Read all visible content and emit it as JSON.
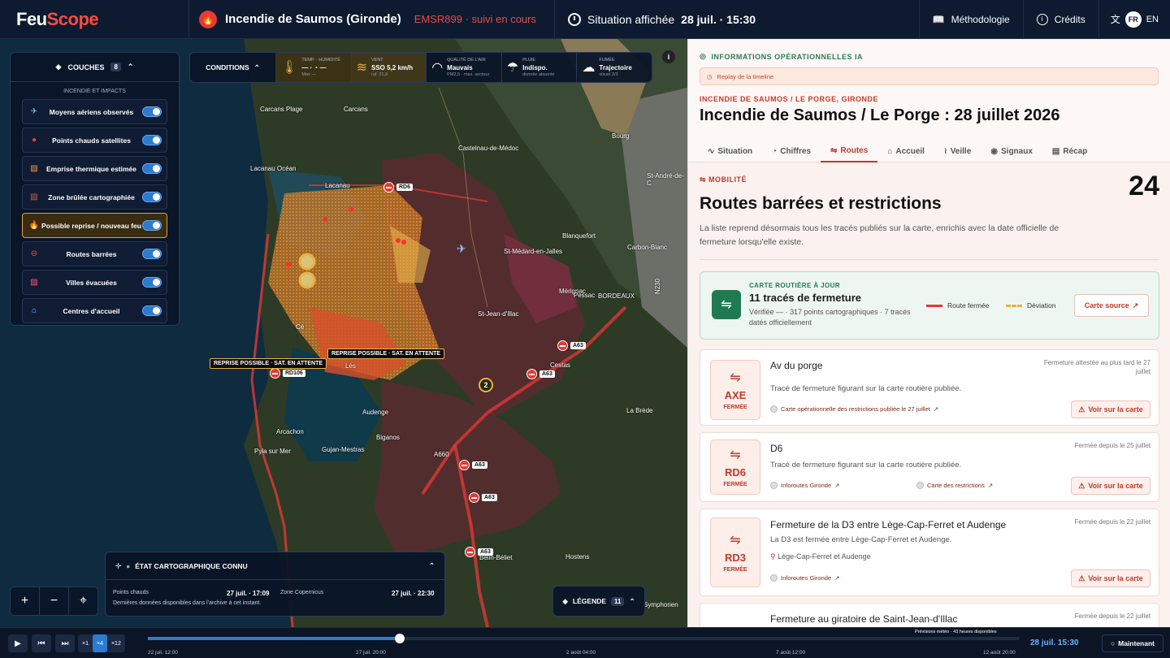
{
  "topbar": {
    "logo_a": "Feu",
    "logo_b": "Scope",
    "incident_title": "Incendie de Saumos (Gironde)",
    "incident_code": "EMSR899 · suivi en cours",
    "situation_label": "Situation affichée",
    "situation_time": "28 juil. · 15:30",
    "methodologie": "Méthodologie",
    "credits": "Crédits",
    "lang_fr": "FR",
    "lang_en": "EN"
  },
  "layers": {
    "title": "COUCHES",
    "count": "8",
    "section": "INCENDIE ET IMPACTS",
    "items": [
      {
        "label": "Moyens aériens observés",
        "icon": "plane-icon"
      },
      {
        "label": "Points chauds satellites",
        "icon": "hotspot-icon"
      },
      {
        "label": "Emprise thermique estimée",
        "icon": "thermal-icon"
      },
      {
        "label": "Zone brûlée cartographiée",
        "icon": "burned-icon"
      },
      {
        "label": "Possible reprise / nouveau feu",
        "icon": "flame-icon"
      },
      {
        "label": "Routes barrées",
        "icon": "road-block-icon"
      },
      {
        "label": "Villes évacuées",
        "icon": "evacuated-icon"
      },
      {
        "label": "Centres d'accueil",
        "icon": "shelter-icon"
      }
    ]
  },
  "conditions": {
    "title": "CONDITIONS",
    "items": [
      {
        "k": "TEMP. · HUMIDITÉ",
        "v": "— · ◔ —",
        "s": "Max —"
      },
      {
        "k": "VENT",
        "v": "SSO 5,2 km/h",
        "s": "raf. 21,8"
      },
      {
        "k": "QUALITÉ DE L'AIR",
        "v": "Mauvais",
        "s": "PM2,5 · max. secteur"
      },
      {
        "k": "PLUIE",
        "v": "Indispo.",
        "s": "donnée absente"
      },
      {
        "k": "FUMÉE",
        "v": "Trajectoire",
        "s": "visuel 2/3"
      }
    ]
  },
  "map": {
    "places": [
      "Carcans Plage",
      "Carcans",
      "Castelnau-de-Médoc",
      "Bourg",
      "Lacanau Océan",
      "Lacanau",
      "St-André-de-C",
      "Blanquefort",
      "Carbon-Blanc",
      "St-Médard-en-Jalles",
      "Mérignac",
      "BORDEAUX",
      "St-Jean-d'Illac",
      "Pessac",
      "Cestas",
      "Audenge",
      "La Brède",
      "Biganos",
      "Arcachon",
      "Gujan-Mestras",
      "Pyla sur Mer",
      "Belin-Béliet",
      "Hostens",
      "Symphorien",
      "N230",
      "A660",
      "Lès",
      "Cé"
    ],
    "roads": [
      "RD6",
      "RD106",
      "A63",
      "A63",
      "A63",
      "A63",
      "A63"
    ],
    "tags": [
      "REPRISE POSSIBLE · SAT. EN ATTENTE",
      "REPRISE POSSIBLE · SAT. EN ATTENTE"
    ],
    "cluster": "2"
  },
  "etat": {
    "title": "ÉTAT CARTOGRAPHIQUE CONNU",
    "pc_label": "Points chauds",
    "pc_value": "27 juil. · 17:09",
    "zc_label": "Zone Copernicus",
    "zc_value": "27 juil. · 22:30",
    "note": "Dernières données disponibles dans l'archive à cet instant."
  },
  "legend": {
    "label": "LÉGENDE",
    "count": "11"
  },
  "timeline": {
    "speeds": [
      "×1",
      "×4",
      "×12"
    ],
    "labels": [
      "22 juil. 12:00",
      "27 juil. 20:00",
      "2 août 04:00",
      "7 août 12:00",
      "12 août 20:00"
    ],
    "marker": "Maintenant",
    "forecast": "Prévisions météo · 43 heures disponibles",
    "current": "28 juil. 15:30",
    "now_btn": "Maintenant"
  },
  "panel": {
    "ai_info": "INFORMATIONS OPÉRATIONNELLES IA",
    "replay": "Replay de la timeline",
    "crumb": "INCENDIE DE SAUMOS / LE PORGE, GIRONDE",
    "title": "Incendie de Saumos / Le Porge : 28 juillet 2026",
    "tabs": [
      "Situation",
      "Chiffres",
      "Routes",
      "Accueil",
      "Veille",
      "Signaux",
      "Récap"
    ],
    "section_kicker": "MOBILITÉ",
    "count": "24",
    "h2": "Routes barrées et restrictions",
    "desc": "La liste reprend désormais tous les tracés publiés sur la carte, enrichis avec la date officielle de fermeture lorsqu'elle existe.",
    "carte": {
      "kicker": "CARTE ROUTIÈRE À JOUR",
      "title": "11 tracés de fermeture",
      "desc": "Vérifiée — · 317 points cartographiques · 7 tracés datés officiellement",
      "leg_closed": "Route fermée",
      "leg_detour": "Déviation",
      "source_btn": "Carte source"
    },
    "cards": [
      {
        "code": "AXE",
        "status": "FERMÉE",
        "name": "Av du porge",
        "date": "Fermeture attestée au plus tard le 27 juillet",
        "text": "Tracé de fermeture figurant sur la carte routière publiée.",
        "src1": "Carte opérationnelle des restrictions publiée le 27 juillet",
        "src2": "",
        "button": "Voir sur la carte"
      },
      {
        "code": "RD6",
        "status": "FERMÉE",
        "name": "D6",
        "date": "Fermée depuis le 25 juillet",
        "text": "Tracé de fermeture figurant sur la carte routière publiée.",
        "src1": "Inforoutes Gironde",
        "src2": "Carte des restrictions",
        "button": "Voir sur la carte"
      },
      {
        "code": "RD3",
        "status": "FERMÉE",
        "name": "Fermeture de la D3 entre Lège-Cap-Ferret et Audenge",
        "date": "Fermée depuis le 22 juillet",
        "text": "La D3 est fermée entre Lège-Cap-Ferret et Audenge.",
        "place": "Lège-Cap-Ferret et Audenge",
        "src1": "Inforoutes Gironde",
        "src2": "",
        "button": "Voir sur la carte"
      },
      {
        "code": "",
        "status": "",
        "name": "Fermeture au giratoire de Saint-Jean-d'Illac",
        "date": "Fermée depuis le 22 juillet",
        "text": "",
        "src1": "",
        "src2": "",
        "button": ""
      }
    ]
  },
  "colors": {
    "accent": "#c0392b",
    "brand_red": "#ff4b3e",
    "blue": "#2b7bd0",
    "green": "#1f7a52"
  }
}
